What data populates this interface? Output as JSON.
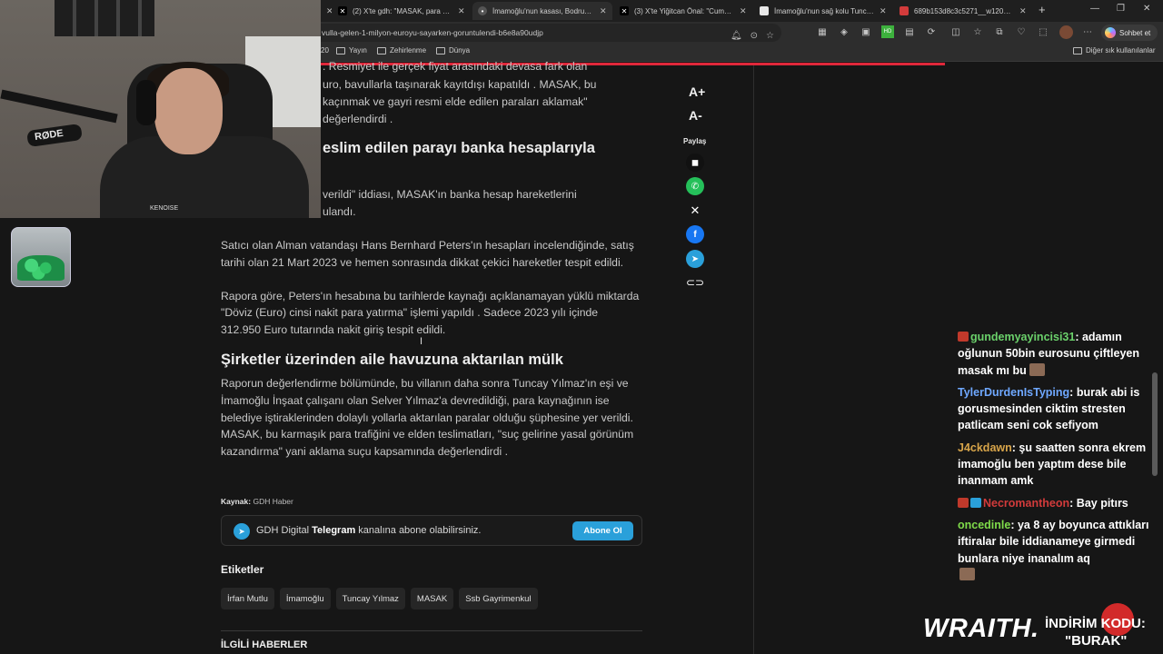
{
  "browser": {
    "tabs": [
      {
        "title": "(2) X'te gdh: \"MASAK, para saym",
        "icon": "x-icon"
      },
      {
        "title": "İmamoğlu'nun kasası, Bodrum'd",
        "icon": "site-icon"
      },
      {
        "title": "(3) X'te Yiğitcan Önal: \"Cumhuri",
        "icon": "x-icon"
      },
      {
        "title": "İmamoğlu'nun sağ kolu Tuncay",
        "icon": "page-icon"
      },
      {
        "title": "689b153d8c3c5271__w1200xh1",
        "icon": "image-icon"
      }
    ],
    "url": "vulla-gelen-1-milyon-euroyu-sayarken-goruntulendi-b6e8a90udjp",
    "chat_button": "Sohbet et",
    "bookmarks": [
      "Yayın",
      "Zehirlenme",
      "Dünya"
    ],
    "bookmark_prefix": "20",
    "other_bookmarks": "Diğer sık kullanılanlar"
  },
  "article": {
    "top_lines": [
      ". Resmiyet ile gerçek fiyat arasındaki devasa fark olan",
      "uro, bavullarla taşınarak kayıtdışı kapatıldı . MASAK, bu",
      "kaçınmak ve gayri resmi elde edilen paraları aklamak\"",
      "değerlendirdi ."
    ],
    "h2_partial_1": "eslim edilen parayı banka hesaplarıyla",
    "p_partial_1": "verildi\" iddiası, MASAK'ın banka hesap hareketlerini",
    "p_partial_2": "ulandı.",
    "p1": "Satıcı olan Alman vatandaşı Hans Bernhard Peters'ın hesapları incelendiğinde, satış tarihi olan 21 Mart 2023 ve hemen sonrasında dikkat çekici hareketler tespit edildi.",
    "p2": "Rapora göre, Peters'ın hesabına bu tarihlerde kaynağı açıklanamayan yüklü miktarda \"Döviz (Euro) cinsi nakit para yatırma\" işlemi yapıldı . Sadece 2023 yılı içinde 312.950 Euro tutarında nakit giriş tespit edildi.",
    "h2": "Şirketler üzerinden aile havuzuna aktarılan mülk",
    "p3": "Raporun değerlendirme bölümünde, bu villanın daha sonra Tuncay Yılmaz'ın eşi ve İmamoğlu İnşaat çalışanı olan Selver Yılmaz'a devredildiği, para kaynağının ise belediye iştiraklerinden dolaylı yollarla aktarılan paralar olduğu şüphesine yer verildi. MASAK, bu karmaşık para trafiğini ve elden teslimatları, \"suç gelirine yasal görünüm kazandırma\" yani aklama suçu kapsamında değerlendirdi .",
    "source_label": "Kaynak:",
    "source_value": "GDH Haber",
    "telegram_pre": "GDH Digital",
    "telegram_bold": "Telegram",
    "telegram_post": "kanalına abone olabilirsiniz.",
    "telegram_button": "Abone Ol",
    "tags_title": "Etiketler",
    "tags": [
      "İrfan Mutlu",
      "İmamoğlu",
      "Tuncay Yılmaz",
      "MASAK",
      "Ssb Gayrimenkul"
    ],
    "related_title": "İLGİLİ HABERLER"
  },
  "share": {
    "font_up": "A+",
    "font_down": "A-",
    "label": "Paylaş"
  },
  "webcam": {
    "mic_brand": "RØDE",
    "hoodie_text": "KENOISE"
  },
  "chat": [
    {
      "user": "gundemyayincisi31",
      "user_color": "#6bd16b",
      "text": "adamın oğlunun 50bin eurosunu çiftleyen masak mı bu",
      "badges": [
        "#c0392b"
      ],
      "emote": true
    },
    {
      "user": "TylerDurdenIsTyping",
      "user_color": "#6fa8ff",
      "text": "burak abi is gorusmesinden ciktim stresten patlicam seni cok sefiyom",
      "badges": [],
      "emote": false
    },
    {
      "user": "J4ckdawn",
      "user_color": "#d8a54a",
      "text": "şu saatten sonra ekrem imamoğlu ben yaptım dese bile inanmam amk",
      "badges": [],
      "emote": false
    },
    {
      "user": "Necromantheon",
      "user_color": "#d23b3b",
      "text": "Bay pitırs",
      "badges": [
        "#c0392b",
        "#2aa0da"
      ],
      "emote": false
    },
    {
      "user": "oncedinle",
      "user_color": "#7fdc4a",
      "text": "ya 8 ay boyunca attıkları iftiralar bile iddianameye girmedi bunlara niye inanalım aq",
      "badges": [],
      "emote": true
    }
  ],
  "sponsor": {
    "brand": "WRAITH.",
    "promo_label": "İNDİRİM KODU:",
    "promo_code": "\"BURAK\""
  }
}
